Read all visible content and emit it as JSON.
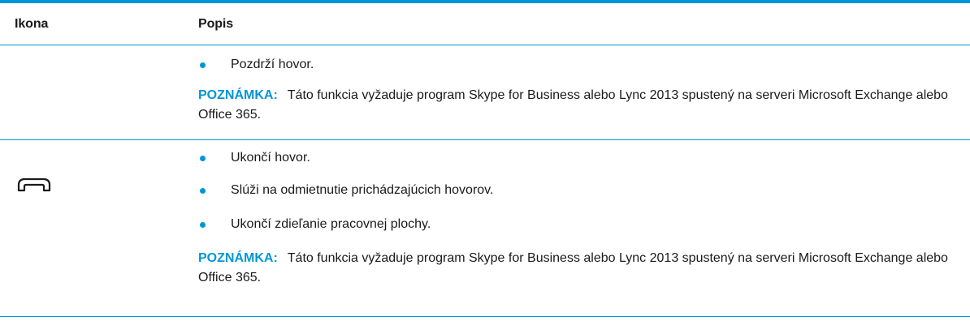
{
  "table": {
    "header": {
      "icon_col": "Ikona",
      "desc_col": "Popis"
    },
    "rows": [
      {
        "icon": "",
        "bullets": [
          "Pozdrží hovor."
        ],
        "note_label": "POZNÁMKA:",
        "note_text": "Táto funkcia vyžaduje program Skype for Business alebo Lync 2013 spustený na serveri Microsoft Exchange alebo Office 365."
      },
      {
        "icon": "hang-up-phone-icon",
        "bullets": [
          "Ukončí hovor.",
          "Slúži na odmietnutie prichádzajúcich hovorov.",
          "Ukončí zdieľanie pracovnej plochy."
        ],
        "note_label": "POZNÁMKA:",
        "note_text": "Táto funkcia vyžaduje program Skype for Business alebo Lync 2013 spustený na serveri Microsoft Exchange alebo Office 365."
      }
    ]
  },
  "colors": {
    "accent": "#0096d6",
    "text": "#1a1a1a"
  }
}
